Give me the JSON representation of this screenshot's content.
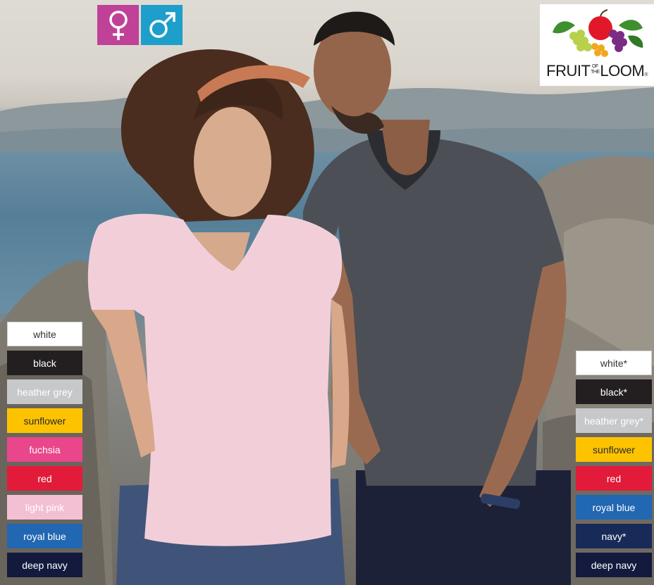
{
  "gender_icons": [
    {
      "symbol": "♀",
      "color": "#c04198"
    },
    {
      "symbol": "♂",
      "color": "#1e9ecb"
    }
  ],
  "brand": {
    "logo_text": "FRUIT",
    "logo_small_top": "OF",
    "logo_small_bottom": "THE",
    "logo_text_end": "LOOM",
    "logo_mark": "®"
  },
  "women_colours": [
    {
      "label": "white",
      "bg": "#ffffff",
      "fg": "#333333"
    },
    {
      "label": "black",
      "bg": "#231f20",
      "fg": "#ffffff"
    },
    {
      "label": "heather grey",
      "bg": "#c6c8ca",
      "fg": "#ffffff"
    },
    {
      "label": "sunflower",
      "bg": "#fdc300",
      "fg": "#2a2a2a"
    },
    {
      "label": "fuchsia",
      "bg": "#e9468b",
      "fg": "#ffffff"
    },
    {
      "label": "red",
      "bg": "#e31b3a",
      "fg": "#ffffff"
    },
    {
      "label": "light pink",
      "bg": "#f3bfd3",
      "fg": "#ffffff"
    },
    {
      "label": "royal blue",
      "bg": "#2167b2",
      "fg": "#ffffff"
    },
    {
      "label": "deep navy",
      "bg": "#131a3d",
      "fg": "#ffffff"
    }
  ],
  "men_colours": [
    {
      "label": "white*",
      "bg": "#ffffff",
      "fg": "#333333"
    },
    {
      "label": "black*",
      "bg": "#231f20",
      "fg": "#ffffff"
    },
    {
      "label": "heather grey*",
      "bg": "#c6c8ca",
      "fg": "#ffffff"
    },
    {
      "label": "sunflower",
      "bg": "#fdc300",
      "fg": "#2a2a2a"
    },
    {
      "label": "red",
      "bg": "#e31b3a",
      "fg": "#ffffff"
    },
    {
      "label": "royal blue",
      "bg": "#2167b2",
      "fg": "#ffffff"
    },
    {
      "label": "navy*",
      "bg": "#182a58",
      "fg": "#ffffff"
    },
    {
      "label": "deep navy",
      "bg": "#131a3d",
      "fg": "#ffffff"
    }
  ]
}
